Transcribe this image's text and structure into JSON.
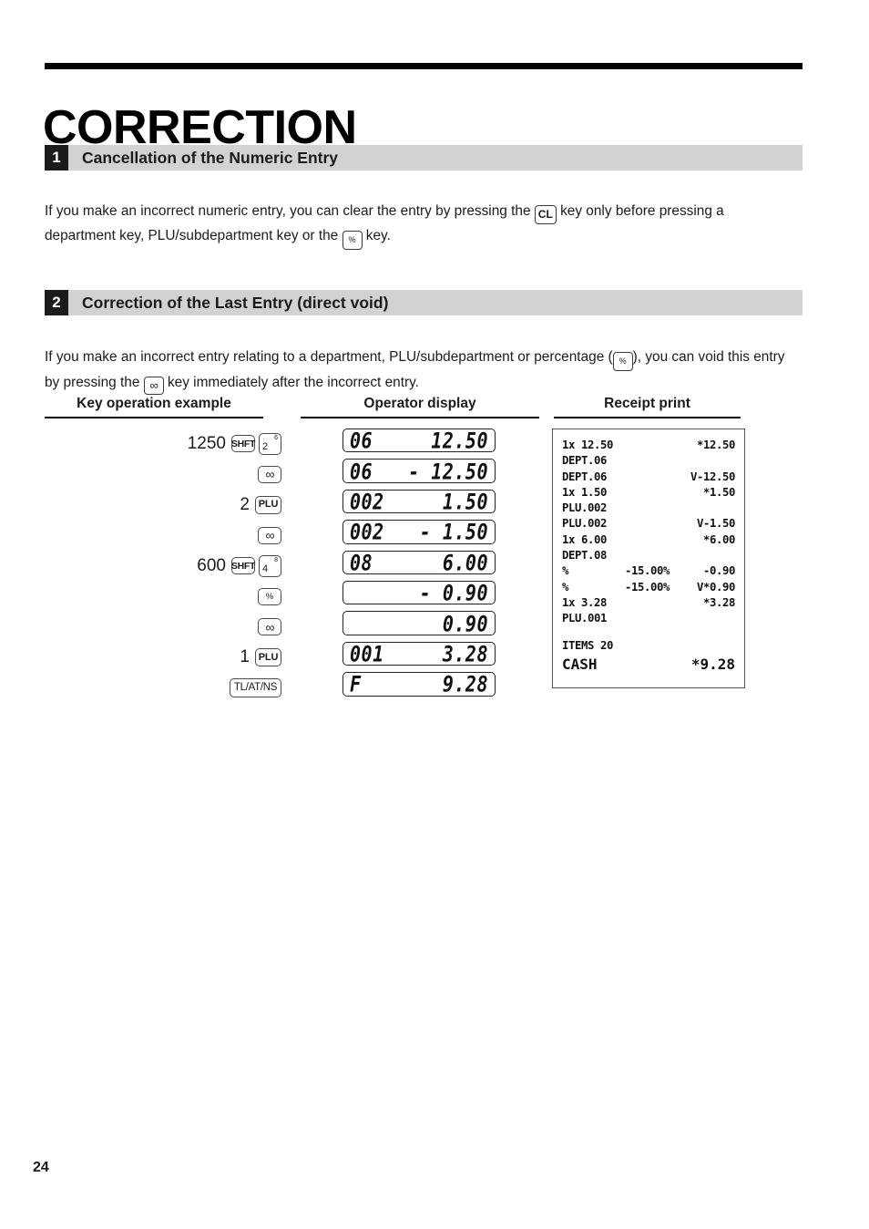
{
  "document": {
    "title": "CORRECTION",
    "page_number": "24"
  },
  "sections": [
    {
      "number": "1",
      "heading": "Cancellation of the Numeric Entry",
      "body_part_1": "If you make an incorrect numeric entry, you can clear the entry by pressing the",
      "key_1": "CL",
      "body_part_2": "key only before pressing a department key, PLU/subdepartment key or the",
      "key_2": "%",
      "body_part_3": "key."
    },
    {
      "number": "2",
      "heading": "Correction of the Last Entry (direct void)",
      "body_part_1": "If you make an incorrect entry relating to a department, PLU/subdepartment or percentage (",
      "key_1": "%",
      "body_part_2": "), you can void this entry by pressing the",
      "key_2": "∞",
      "body_part_3": "key immediately after the incorrect entry."
    }
  ],
  "table": {
    "headers": {
      "key_operation": "Key operation example",
      "operator_display": "Operator display",
      "receipt_print": "Receipt print"
    },
    "key_operation_rows": [
      {
        "number": "1250",
        "keys": [
          {
            "type": "shft",
            "label": "SHFT"
          },
          {
            "type": "dept",
            "label": "2",
            "sup": "6"
          }
        ]
      },
      {
        "number": "",
        "keys": [
          {
            "type": "void",
            "label": "∞"
          }
        ]
      },
      {
        "number": "2",
        "keys": [
          {
            "type": "plu",
            "label": "PLU"
          }
        ]
      },
      {
        "number": "",
        "keys": [
          {
            "type": "void",
            "label": "∞"
          }
        ]
      },
      {
        "number": "600",
        "keys": [
          {
            "type": "shft",
            "label": "SHFT"
          },
          {
            "type": "dept",
            "label": "4",
            "sup": "8"
          }
        ]
      },
      {
        "number": "",
        "keys": [
          {
            "type": "pct",
            "label": "%"
          }
        ]
      },
      {
        "number": "",
        "keys": [
          {
            "type": "void",
            "label": "∞"
          }
        ]
      },
      {
        "number": "1",
        "keys": [
          {
            "type": "plu",
            "label": "PLU"
          }
        ]
      },
      {
        "number": "",
        "keys": [
          {
            "type": "tlatns",
            "label": "TL/AT/NS"
          }
        ]
      }
    ],
    "operator_display_rows": [
      {
        "left": "06",
        "right": "12.50"
      },
      {
        "left": "06",
        "right": "- 12.50"
      },
      {
        "left": "002",
        "right": "1.50"
      },
      {
        "left": "002",
        "right": "- 1.50"
      },
      {
        "left": "08",
        "right": "6.00"
      },
      {
        "left": "",
        "right": "- 0.90"
      },
      {
        "left": "",
        "right": "0.90"
      },
      {
        "left": "001",
        "right": "3.28"
      },
      {
        "left": "F",
        "right": "9.28"
      }
    ],
    "receipt_lines": [
      {
        "left": "1x 12.50",
        "mid": "",
        "right": "*12.50"
      },
      {
        "left": "DEPT.06",
        "mid": "",
        "right": ""
      },
      {
        "left": "DEPT.06",
        "mid": "",
        "right": "V-12.50"
      },
      {
        "left": "1x 1.50",
        "mid": "",
        "right": "*1.50"
      },
      {
        "left": "PLU.002",
        "mid": "",
        "right": ""
      },
      {
        "left": "PLU.002",
        "mid": "",
        "right": "V-1.50"
      },
      {
        "left": "1x 6.00",
        "mid": "",
        "right": "*6.00"
      },
      {
        "left": "DEPT.08",
        "mid": "",
        "right": ""
      },
      {
        "left": "%",
        "mid": "-15.00%",
        "right": "-0.90"
      },
      {
        "left": "%",
        "mid": "-15.00%",
        "right": "V*0.90"
      },
      {
        "left": "1x 3.28",
        "mid": "",
        "right": "*3.28"
      },
      {
        "left": "PLU.001",
        "mid": "",
        "right": ""
      }
    ],
    "receipt_footer": [
      {
        "left": "ITEMS 20",
        "right": ""
      },
      {
        "left": "CASH",
        "right": "*9.28"
      }
    ]
  }
}
